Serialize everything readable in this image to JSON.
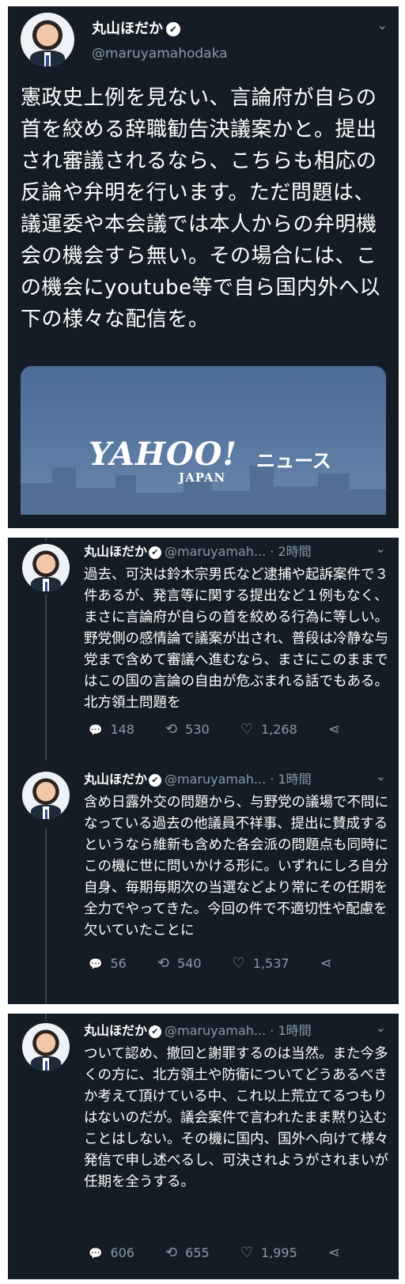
{
  "main_tweet": {
    "name": "丸山ほだか",
    "handle": "@maruyamahodaka",
    "text": "憲政史上例を見ない、言論府が自らの首を絞める辞職勧告決議案かと。提出され審議されるなら、こちらも相応の反論や弁明を行います。ただ問題は、議運委や本会議では本人からの弁明機会の機会すら無い。その場合には、この機会にyoutube等で自ら国内外へ以下の様々な配信を。",
    "card": {
      "logo": "YAHOO!",
      "logo_sub": "JAPAN",
      "label": "ニュース"
    }
  },
  "replies": [
    {
      "name": "丸山ほだか",
      "meta": "@maruyamah... · 2時間",
      "text": "過去、可決は鈴木宗男氏など逮捕や起訴案件で３件あるが、発言等に関する提出など１例もなく、まさに言論府が自らの首を絞める行為に等しい。野党側の感情論で議案が出され、普段は冷静な与党まで含めて審議へ進むなら、まさにこのままではこの国の言論の自由が危ぶまれる話でもある。北方領土問題を",
      "replies": "148",
      "retweets": "530",
      "likes": "1,268"
    },
    {
      "name": "丸山ほだか",
      "meta": "@maruyamah... · 1時間",
      "text": "含め日露外交の問題から、与野党の議場で不問になっている過去の他議員不祥事、提出に賛成するというなら維新も含めた各会派の問題点も同時にこの機に世に問いかける形に。いずれにしろ自分自身、毎期毎期次の当選などより常にその任期を全力でやってきた。今回の件で不適切性や配慮を欠いていたことに",
      "replies": "56",
      "retweets": "540",
      "likes": "1,537"
    },
    {
      "name": "丸山ほだか",
      "meta": "@maruyamah... · 1時間",
      "text": "ついて認め、撤回と謝罪するのは当然。また今多くの方に、北方領土や防衛についてどうあるべきか考えて頂けている中、これ以上荒立てるつもりはないのだが。議会案件で言われたまま黙り込むことはしない。その機に国内、国外へ向けて様々発信で申し述べるし、可決されようがされまいが任期を全うする。",
      "replies": "606",
      "retweets": "655",
      "likes": "1,995"
    }
  ],
  "icons": {
    "verified": "✔",
    "chevron": "⌄",
    "reply": "💬",
    "retweet": "⟲",
    "like": "♡",
    "share": "⋖"
  }
}
